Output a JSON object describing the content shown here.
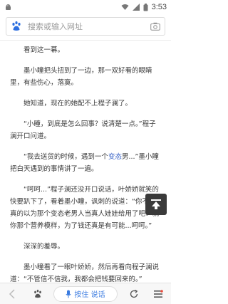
{
  "status_bar": {
    "time": "3:53"
  },
  "search": {
    "placeholder": "搜索或输入网址"
  },
  "article": {
    "paragraphs": [
      "看到这一幕。",
      "墨小瞳把头扭到了一边，那一双好看的眼睛里，有些伤心，落寞。",
      "她知道，现在的她配不上程子澜了。",
      "“小瞳，到底是怎么回事？说清楚一点。”程子澜开口问道。",
      "“我去送货的时候，遇到一个变态男...”墨小瞳把白天遇到的事情讲了一遍。",
      "“呵呵...”程子澜还没开口说话，叶娇娇就笑的快要趴下了，看着墨小瞳，讽刺的说道：“你不会真的以为那个变态老男人当真人娃娃给用了吧？就你那个营养模样，为了钱还真是有可能...呵呵。”",
      "深深的羞辱。",
      "墨小瞳看了一眼叶娇娇，然后再看向程子澜说道：“不管信不信我，我都会把钱要回来的。”"
    ],
    "link_text": "变态"
  },
  "bottom_bar": {
    "voice_label": "按住 说话"
  },
  "colors": {
    "accent": "#3b7be0",
    "link": "#3a64c8"
  }
}
